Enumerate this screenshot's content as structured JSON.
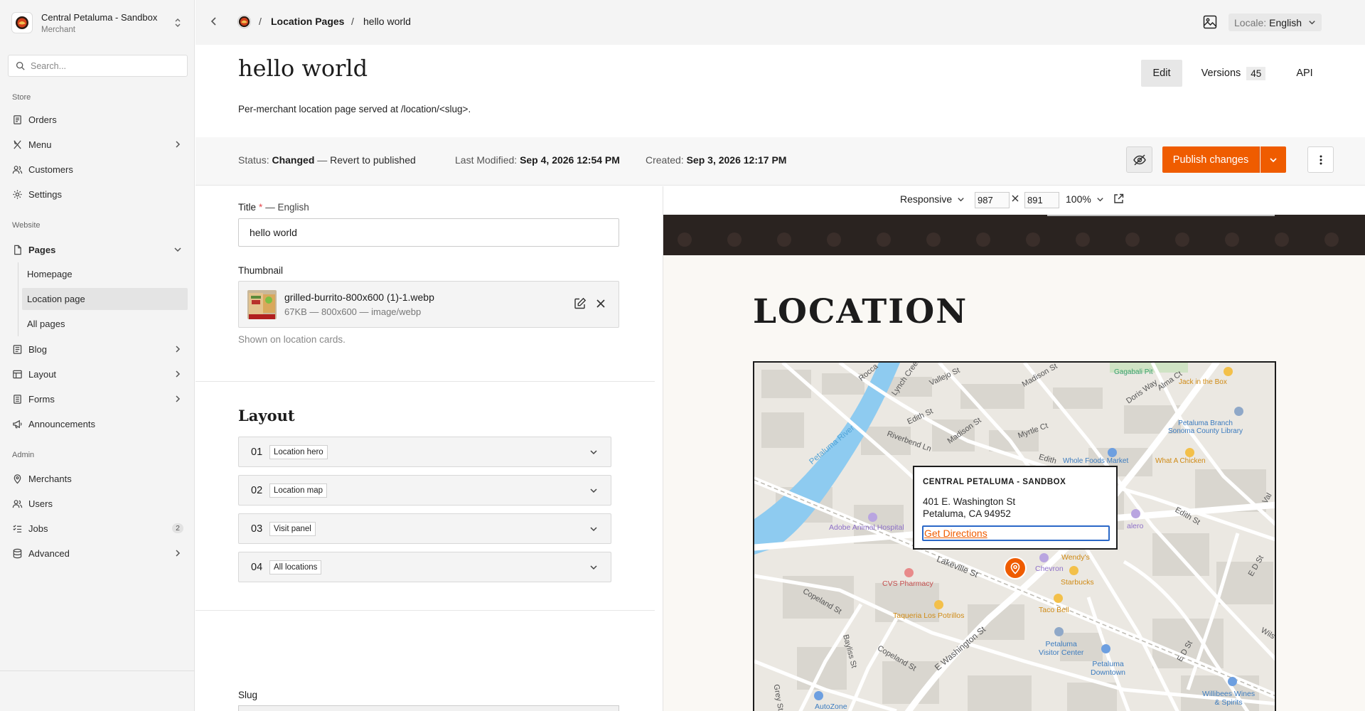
{
  "sidebar": {
    "store_name": "Central Petaluma - Sandbox",
    "store_role": "Merchant",
    "search_placeholder": "Search...",
    "section_store": "Store",
    "section_website": "Website",
    "section_admin": "Admin",
    "items": {
      "orders": "Orders",
      "menu": "Menu",
      "customers": "Customers",
      "settings": "Settings",
      "pages": "Pages",
      "homepage": "Homepage",
      "location_page": "Location page",
      "all_pages": "All pages",
      "blog": "Blog",
      "layout": "Layout",
      "forms": "Forms",
      "announcements": "Announcements",
      "merchants": "Merchants",
      "users": "Users",
      "jobs": "Jobs",
      "jobs_badge": "2",
      "advanced": "Advanced"
    }
  },
  "topbar": {
    "breadcrumb_sep": "/",
    "breadcrumb_parent": "Location Pages",
    "breadcrumb_current": "hello world",
    "locale_label": "Locale:",
    "locale_value": "English"
  },
  "header": {
    "title": "hello world",
    "description": "Per-merchant location page served at /location/<slug>.",
    "tabs": {
      "edit": "Edit",
      "versions": "Versions",
      "versions_count": "45",
      "api": "API"
    }
  },
  "status": {
    "status_label": "Status:",
    "status_value": "Changed",
    "dash": "—",
    "revert_link": "Revert to published",
    "modified_label": "Last Modified:",
    "modified_value": "Sep 4, 2026 12:54 PM",
    "created_label": "Created:",
    "created_value": "Sep 3, 2026 12:17 PM",
    "publish_label": "Publish changes"
  },
  "form": {
    "title_label": "Title",
    "title_required": "*",
    "title_lang": "— English",
    "title_value": "hello world",
    "thumbnail_label": "Thumbnail",
    "thumbnail_name": "grilled-burrito-800x600 (1)-1.webp",
    "thumbnail_meta": "67KB — 800x600 — image/webp",
    "thumbnail_help": "Shown on location cards.",
    "layout_title": "Layout",
    "blocks": [
      {
        "num": "01",
        "name": "Location hero"
      },
      {
        "num": "02",
        "name": "Location map"
      },
      {
        "num": "03",
        "name": "Visit panel"
      },
      {
        "num": "04",
        "name": "All locations"
      }
    ],
    "slug_label": "Slug"
  },
  "preview": {
    "viewport": "Responsive",
    "width": "987",
    "height": "891",
    "zoom": "100%",
    "heading": "LOCATION",
    "popup": {
      "title": "CENTRAL PETALUMA - SANDBOX",
      "address_line1": "401 E. Washington St",
      "address_line2": "Petaluma, CA 94952",
      "directions": "Get Directions"
    },
    "map_labels": {
      "rocca": "Rocca",
      "lynch_creek": "Lynch Creek",
      "vallejo": "Vallejo St",
      "madison_top": "Madison St",
      "alma": "Alma Ct",
      "doris": "Doris Way",
      "gagabaili": "Gagabali Pit",
      "jack_box": "Jack in the Box",
      "library": "Petaluma Branch\nSonoma County Library",
      "edith_top": "Edith St",
      "madison_mid": "Madison St",
      "myrtle": "Myrtle Ct",
      "riverbend": "Riverbend Ln",
      "whole_foods": "Whole Foods Market",
      "what_chicken": "What A Chicken",
      "edith_clip": "Edith",
      "petaluma_river": "Petaluma River",
      "vallejo_clip": "Val",
      "edith_right": "Edith St",
      "galero": "alero",
      "adobe": "Adobe Animal Hospital",
      "wendys": "Wendy's",
      "chevron": "Chevron",
      "starbucks": "Starbucks",
      "lakeville": "Lakeville St",
      "cvs": "CVS Pharmacy",
      "taco_bell": "Taco Bell",
      "eds_st": "E D St",
      "copeland_left": "Copeland St",
      "taqueria": "Taqueria Los Potrillos",
      "bayliss": "Bayliss St",
      "e_washington": "E Washington St",
      "copeland_low": "Copeland St",
      "visitor_center": "Petaluma\nVisitor Center",
      "petaluma_downtown": "Petaluma\nDowntown",
      "ed_st_low": "E D St",
      "wils": "Wils",
      "grey_st": "Grey St",
      "autozone": "AutoZone",
      "willibees": "Willibees Wines\n& Spirits"
    }
  },
  "colors": {
    "accent": "#ef5c00",
    "sidebar_bg": "#f4f4f4",
    "site_nav": "#2a2320"
  }
}
